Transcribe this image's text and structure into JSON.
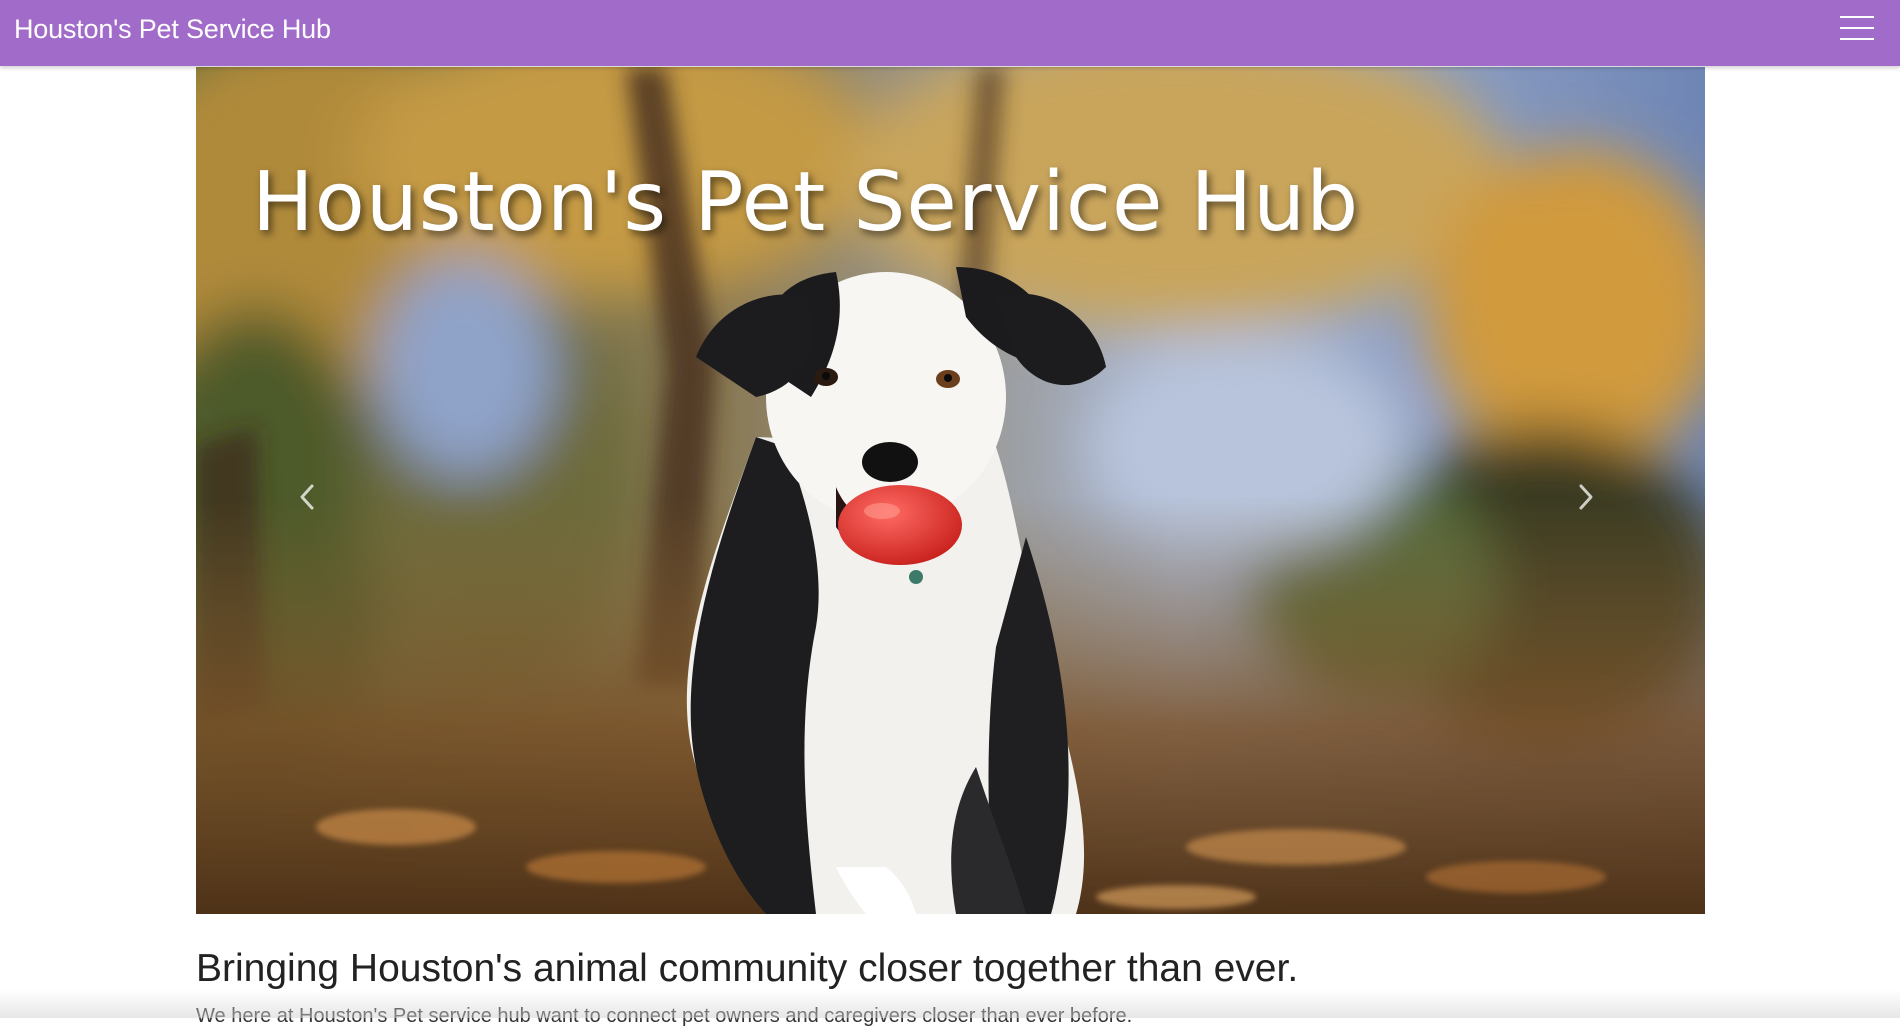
{
  "navbar": {
    "brand": "Houston's Pet Service Hub",
    "menu_icon": "hamburger-menu-icon",
    "background": "#a16bc9"
  },
  "carousel": {
    "slide_title": "Houston's Pet Service Hub",
    "image_alt": "Border collie running with a red ball in an autumn park",
    "prev_icon": "chevron-left-icon",
    "next_icon": "chevron-right-icon"
  },
  "content": {
    "tagline": "Bringing Houston's animal community closer together than ever.",
    "intro": "We here at Houston's Pet service hub want to connect pet owners and caregivers closer than ever before."
  }
}
